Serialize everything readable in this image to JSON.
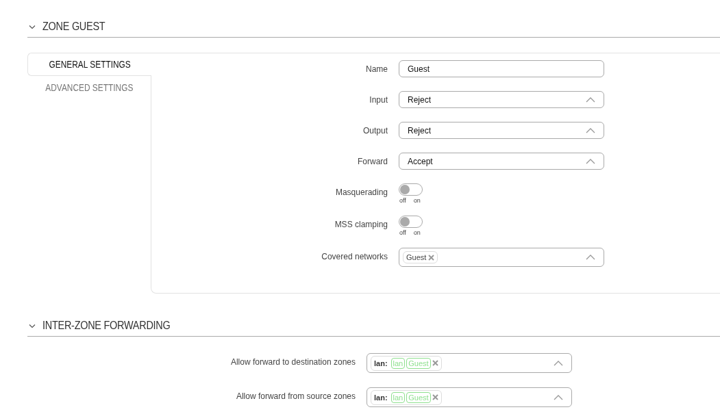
{
  "sections": [
    {
      "title": "ZONE GUEST",
      "expanded": true,
      "tabs": [
        {
          "label": "GENERAL SETTINGS",
          "selected": true
        },
        {
          "label": "ADVANCED SETTINGS",
          "selected": false
        }
      ],
      "fields": [
        {
          "kind": "text",
          "label": "Name",
          "value": "Guest"
        },
        {
          "kind": "select",
          "label": "Input",
          "value": "Reject"
        },
        {
          "kind": "select",
          "label": "Output",
          "value": "Reject"
        },
        {
          "kind": "select",
          "label": "Forward",
          "value": "Accept"
        },
        {
          "kind": "toggle",
          "label": "Masquerading",
          "on": false,
          "off_label": "off",
          "on_label": "on"
        },
        {
          "kind": "toggle",
          "label": "MSS clamping",
          "on": false,
          "off_label": "off",
          "on_label": "on"
        },
        {
          "kind": "tags",
          "label": "Covered networks",
          "tags": [
            "Guest"
          ]
        }
      ]
    },
    {
      "title": "INTER-ZONE FORWARDING",
      "expanded": true,
      "fields": [
        {
          "kind": "zones",
          "label": "Allow forward to destination zones",
          "prefix": "lan:",
          "tags": [
            "lan",
            "Guest"
          ]
        },
        {
          "kind": "zones",
          "label": "Allow forward from source zones",
          "prefix": "lan:",
          "tags": [
            "lan",
            "Guest"
          ]
        }
      ]
    }
  ]
}
